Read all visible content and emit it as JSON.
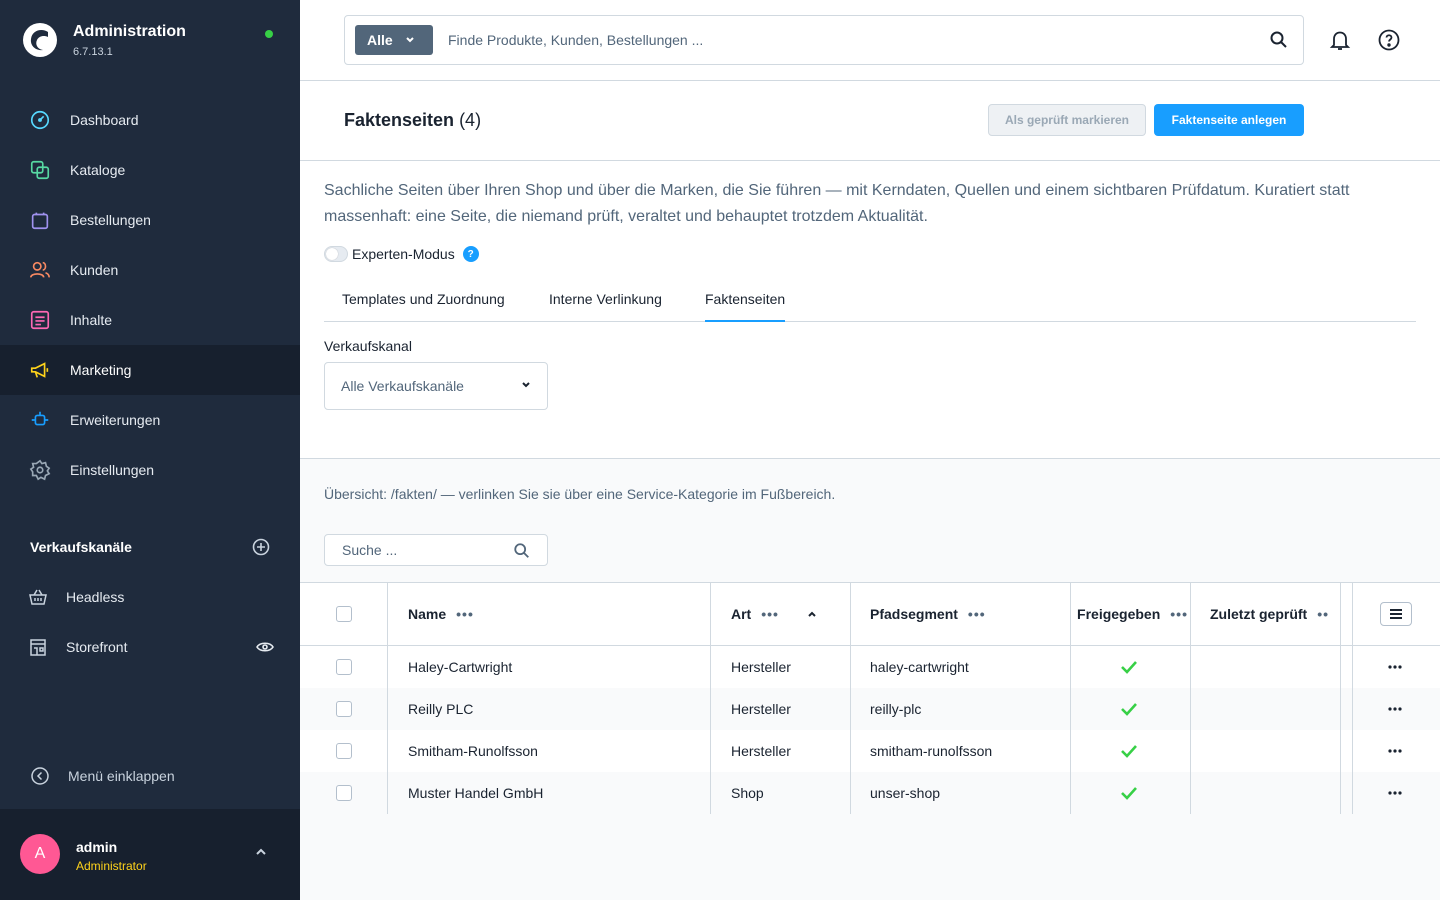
{
  "app": {
    "title": "Administration",
    "version": "6.7.13.1",
    "status_color": "#37d046"
  },
  "sidebar": {
    "items": [
      {
        "label": "Dashboard",
        "icon": "dashboard-icon",
        "color": "#57d9ff"
      },
      {
        "label": "Kataloge",
        "icon": "catalog-icon",
        "color": "#57d9a3"
      },
      {
        "label": "Bestellungen",
        "icon": "orders-icon",
        "color": "#a092f0"
      },
      {
        "label": "Kunden",
        "icon": "customers-icon",
        "color": "#f88962"
      },
      {
        "label": "Inhalte",
        "icon": "content-icon",
        "color": "#ff68b4"
      },
      {
        "label": "Marketing",
        "icon": "marketing-icon",
        "color": "#ffd31b",
        "active": true
      },
      {
        "label": "Erweiterungen",
        "icon": "extensions-icon",
        "color": "#189eff"
      },
      {
        "label": "Einstellungen",
        "icon": "settings-icon",
        "color": "#9aa8b5"
      }
    ],
    "channels_title": "Verkaufskanäle",
    "channels": [
      {
        "label": "Headless",
        "icon": "basket-icon"
      },
      {
        "label": "Storefront",
        "icon": "storefront-icon"
      }
    ],
    "collapse_label": "Menü einklappen"
  },
  "user": {
    "initial": "A",
    "name": "admin",
    "role": "Administrator"
  },
  "search": {
    "type_label": "Alle",
    "placeholder": "Finde Produkte, Kunden, Bestellungen ..."
  },
  "page": {
    "title": "Faktenseiten",
    "count": "(4)",
    "mark_button": "Als geprüft markieren",
    "create_button": "Faktenseite anlegen",
    "intro": "Sachliche Seiten über Ihren Shop und über die Marken, die Sie führen — mit Kerndaten, Quellen und einem sichtbaren Prüfdatum. Kuratiert statt massenhaft: eine Seite, die niemand prüft, veraltet und behauptet trotzdem Aktualität.",
    "expert_label": "Experten-Modus",
    "help_glyph": "?",
    "tabs": [
      "Templates und Zuordnung",
      "Interne Verlinkung",
      "Faktenseiten"
    ],
    "active_tab": "Faktenseiten",
    "channel_label": "Verkaufskanal",
    "channel_value": "Alle Verkaufskanäle",
    "overview": "Übersicht: /fakten/ — verlinken Sie sie über eine Service-Kategorie im Fußbereich.",
    "grid_search_placeholder": "Suche ..."
  },
  "grid": {
    "columns": [
      "Name",
      "Art",
      "Pfadsegment",
      "Freigegeben",
      "Zuletzt geprüft"
    ],
    "rows": [
      {
        "name": "Haley-Cartwright",
        "type": "Hersteller",
        "path": "haley-cartwright",
        "approved": true,
        "checked": ""
      },
      {
        "name": "Reilly PLC",
        "type": "Hersteller",
        "path": "reilly-plc",
        "approved": true,
        "checked": ""
      },
      {
        "name": "Smitham-Runolfsson",
        "type": "Hersteller",
        "path": "smitham-runolfsson",
        "approved": true,
        "checked": ""
      },
      {
        "name": "Muster Handel GmbH",
        "type": "Shop",
        "path": "unser-shop",
        "approved": true,
        "checked": ""
      }
    ]
  },
  "colors": {
    "accent": "#189eff",
    "sidebar_bg": "#1f2b3d",
    "check": "#37d046"
  }
}
